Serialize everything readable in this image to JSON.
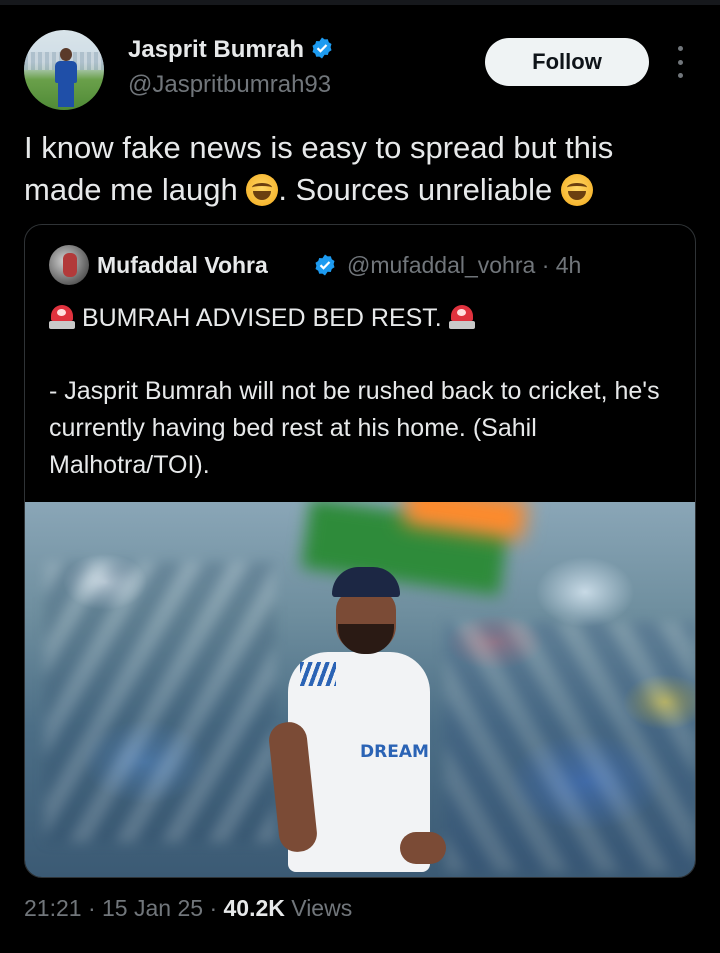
{
  "author": {
    "name": "Jasprit Bumrah",
    "handle": "@Jaspritbumrah93",
    "verified": true,
    "follow_label": "Follow"
  },
  "tweet": {
    "text_part1": "I know fake news is easy to spread but this made me laugh ",
    "text_part2": ".  Sources unreliable ",
    "emoji": "face-with-tears-of-joy"
  },
  "quoted_tweet": {
    "name": "Mufaddal Vohra",
    "handle": "@mufaddal_vohra",
    "separator": "·",
    "time": "4h",
    "headline": "BUMRAH ADVISED BED REST.",
    "headline_icon": "police-siren",
    "body": "- Jasprit Bumrah will not be rushed back to cricket, he's currently having bed rest at his home. (Sahil Malhotra/TOI).",
    "photo_text": "DREAM"
  },
  "footer": {
    "time": "21:21",
    "separator": "·",
    "date": "15 Jan 25",
    "views_count": "40.2K",
    "views_label": "Views"
  },
  "colors": {
    "background": "#000000",
    "text": "#e7e9ea",
    "muted": "#71767b",
    "verified": "#1d9bf0",
    "border": "#2f3336"
  }
}
